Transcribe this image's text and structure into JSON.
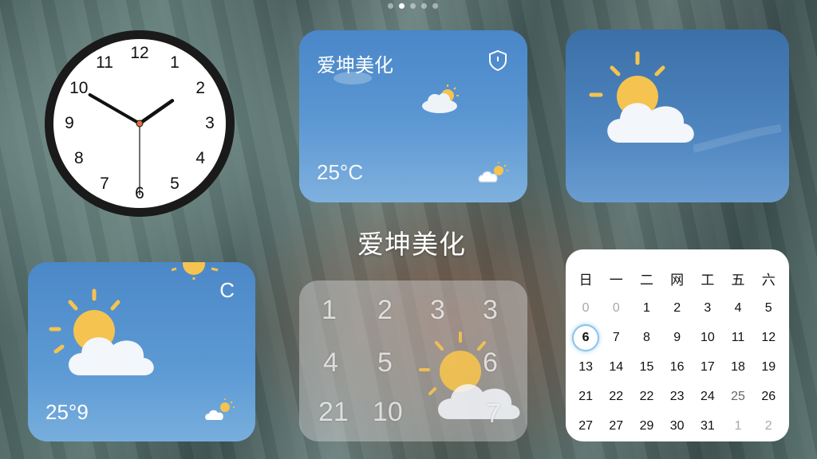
{
  "pager": {
    "count": 5,
    "active": 1
  },
  "clock": {
    "numbers": [
      "12",
      "1",
      "2",
      "3",
      "4",
      "5",
      "6",
      "7",
      "8",
      "9",
      "10",
      "11"
    ],
    "time": {
      "hour": 1,
      "minute": 50,
      "second": 30
    }
  },
  "weather_card_1": {
    "title": "爱坤美化",
    "temperature": "25°C",
    "icon": "partly-cloudy-icon",
    "badge": "shield-icon"
  },
  "weather_card_2": {
    "icon": "partly-cloudy-icon"
  },
  "weather_card_3": {
    "unit": "C",
    "temperature": "25°9",
    "icon": "partly-cloudy-icon"
  },
  "app_label": "爱坤美化",
  "glass_widget": {
    "numbers": [
      "1",
      "2",
      "3",
      "3",
      "4",
      "5",
      "6",
      "21",
      "10",
      "7"
    ],
    "icon": "partly-cloudy-icon"
  },
  "calendar": {
    "weekdays": [
      "日",
      "一",
      "二",
      "网",
      "工",
      "五",
      "六"
    ],
    "weeks": [
      [
        "0",
        "0",
        "1",
        "2",
        "3",
        "4",
        "5"
      ],
      [
        "6",
        "7",
        "8",
        "9",
        "10",
        "11",
        "12"
      ],
      [
        "13",
        "14",
        "15",
        "16",
        "17",
        "18",
        "19"
      ],
      [
        "21",
        "22",
        "22",
        "23",
        "24",
        "25",
        "26"
      ],
      [
        "27",
        "27",
        "29",
        "30",
        "31",
        "1",
        "2"
      ]
    ],
    "today": "6"
  },
  "colors": {
    "sky": "#4a87c9",
    "sun": "#f5c34f",
    "cloud": "#f4f7fb"
  }
}
